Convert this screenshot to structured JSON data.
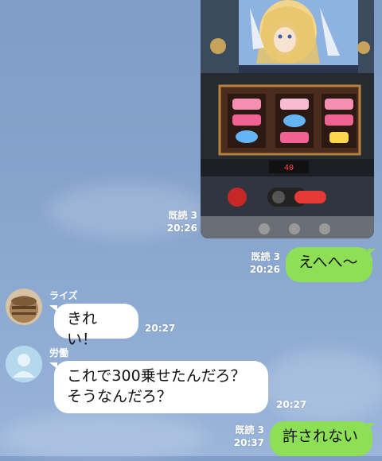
{
  "messages": {
    "m1": {
      "read": "既読 3",
      "time": "20:26"
    },
    "m2": {
      "read": "既読 3",
      "time": "20:26",
      "text": "えへへ〜"
    },
    "m3": {
      "sender": "ライズ",
      "text": "きれい！",
      "time": "20:27"
    },
    "m4": {
      "sender": "労働",
      "line1": "これで300乗せたんだろ？",
      "line2": "そうなんだろ？",
      "time": "20:27"
    },
    "m5": {
      "read": "既読 3",
      "time": "20:37",
      "text": "許されない"
    }
  },
  "photo": {
    "reel_counter": "40"
  },
  "colors": {
    "background": "#86a3cc",
    "outgoing_bubble": "#8de055",
    "incoming_bubble": "#ffffff"
  }
}
